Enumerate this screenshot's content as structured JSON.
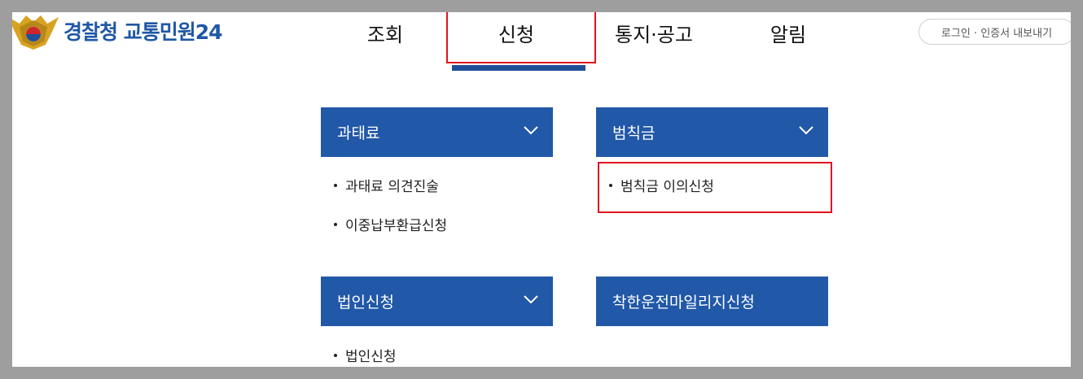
{
  "header": {
    "site_title": "경찰청 교통민원24",
    "nav": [
      "조회",
      "신청",
      "통지·공고",
      "알림"
    ],
    "login": "로그인 · 인증서 내보내기"
  },
  "panels": [
    {
      "title": "과태료",
      "items": [
        "과태료 의견진술",
        "이중납부환급신청"
      ]
    },
    {
      "title": "범칙금",
      "items": [
        "범칙금 이의신청"
      ]
    },
    {
      "title": "법인신청",
      "items": [
        "법인신청"
      ]
    },
    {
      "title": "착한운전마일리지신청",
      "items": []
    }
  ],
  "colors": {
    "brand": "#1f57a6",
    "panel": "#2158a8",
    "highlight": "#e0141e"
  }
}
